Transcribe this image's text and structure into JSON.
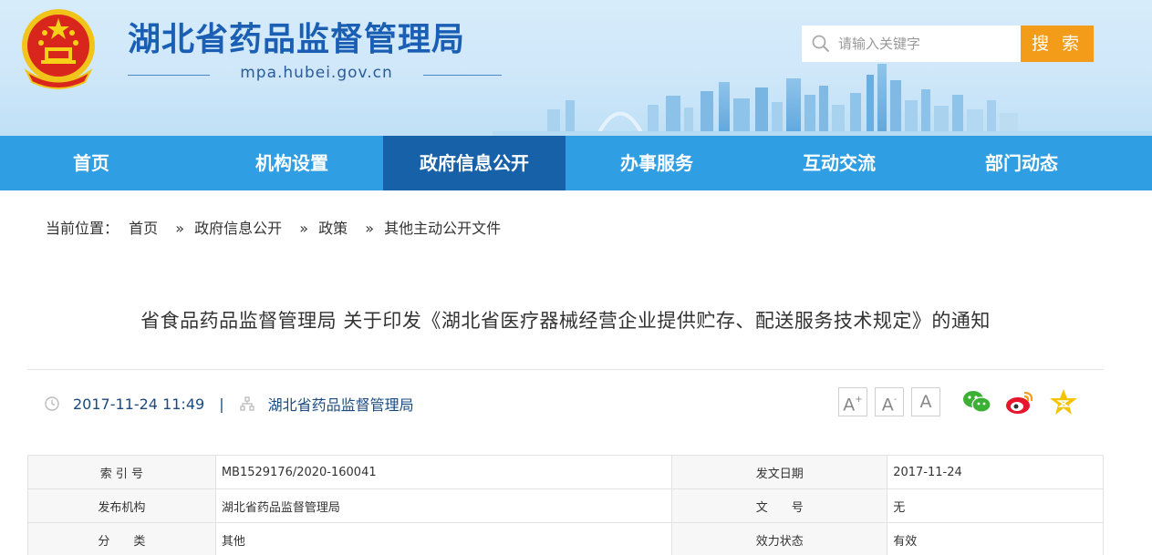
{
  "header": {
    "site_title": "湖北省药品监督管理局",
    "domain": "mpa.hubei.gov.cn",
    "search_placeholder": "请输入关键字",
    "search_button": "搜 索"
  },
  "nav": {
    "items": [
      {
        "label": "首页"
      },
      {
        "label": "机构设置"
      },
      {
        "label": "政府信息公开",
        "active": true
      },
      {
        "label": "办事服务"
      },
      {
        "label": "互动交流"
      },
      {
        "label": "部门动态"
      }
    ]
  },
  "breadcrumb": {
    "prefix": "当前位置：",
    "items": [
      "首页",
      "政府信息公开",
      "政策",
      "其他主动公开文件"
    ],
    "separator": "»"
  },
  "article": {
    "title": "省食品药品监督管理局 关于印发《湖北省医疗器械经营企业提供贮存、配送服务技术规定》的通知",
    "datetime": "2017-11-24 11:49",
    "meta_separator": "|",
    "publisher": "湖北省药品监督管理局"
  },
  "tools": {
    "font_larger": "A",
    "font_smaller": "A",
    "font_default": "A",
    "font_larger_mark": "+",
    "font_smaller_mark": "-"
  },
  "info_table": {
    "rows": [
      {
        "label1": "索 引 号",
        "value1": "MB1529176/2020-160041",
        "label2": "发文日期",
        "value2": "2017-11-24"
      },
      {
        "label1": "发布机构",
        "value1": "湖北省药品监督管理局",
        "label2": "文　　号",
        "value2": "无"
      },
      {
        "label1": "分　　类",
        "value1": "其他",
        "label2": "效力状态",
        "value2": "有效"
      }
    ]
  },
  "colors": {
    "nav_bg": "#2f9ee2",
    "nav_active": "#1761a8",
    "title_blue": "#1a5fb4",
    "search_button": "#f39c1a"
  }
}
